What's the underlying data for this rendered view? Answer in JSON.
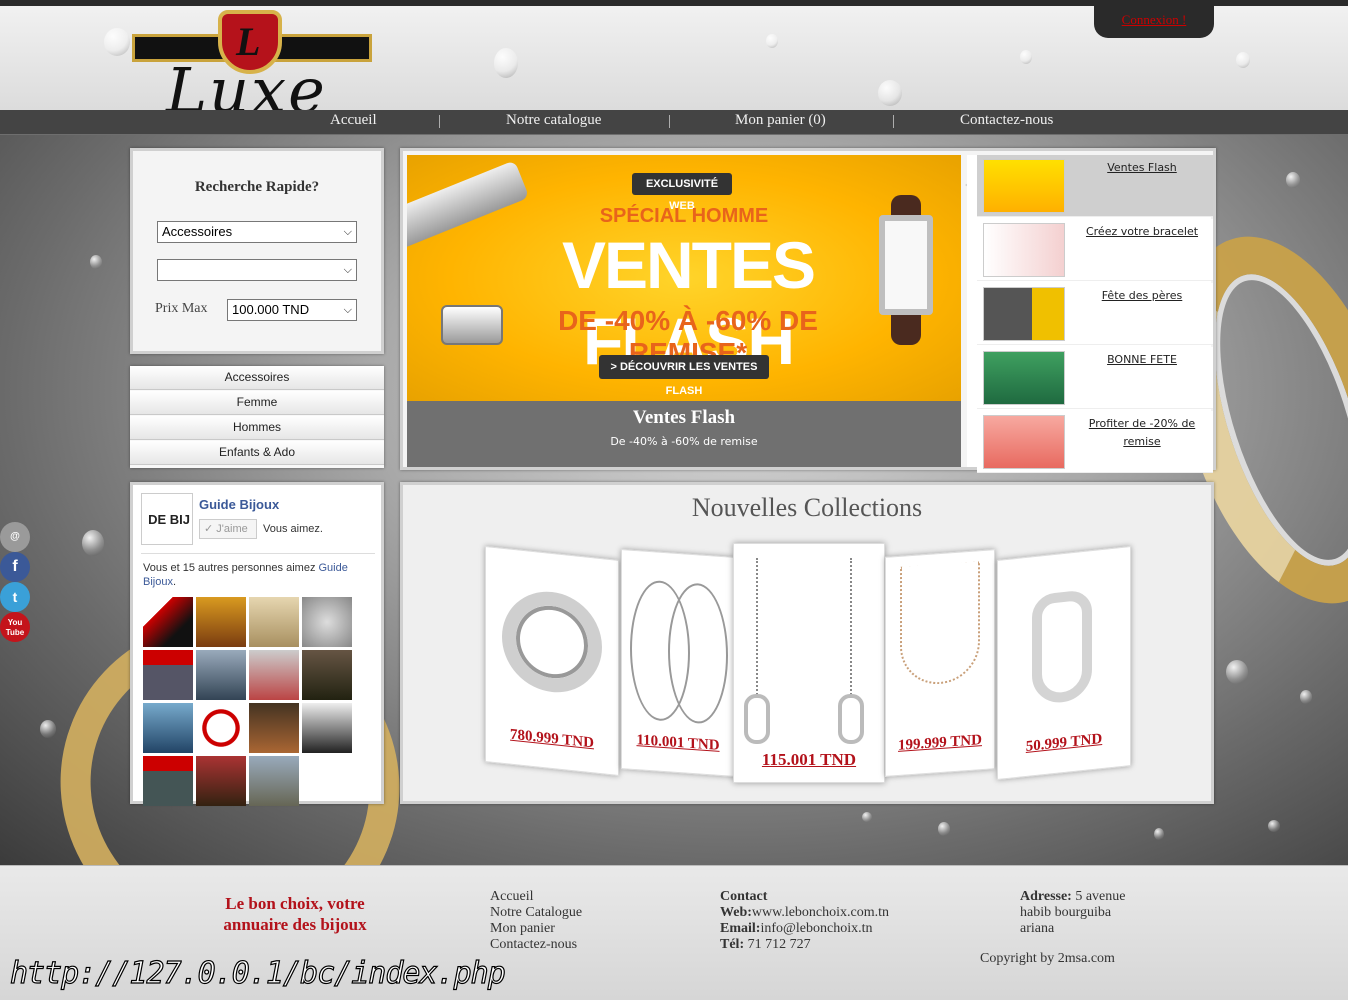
{
  "header": {
    "logo_text": "Luxe",
    "logo_letter": "L",
    "connexion_label": "Connexion !"
  },
  "nav": {
    "items": [
      "Accueil",
      "Notre catalogue",
      "Mon panier (0)",
      "Contactez-nous"
    ],
    "separator": "|"
  },
  "search": {
    "title": "Recherche Rapide?",
    "category_value": "Accessoires",
    "subcategory_value": "",
    "price_label": "Prix Max",
    "price_value": "100.000 TND"
  },
  "categories": [
    "Accessoires",
    "Femme",
    "Hommes",
    "Enfants & Ado"
  ],
  "facebook": {
    "page_name": "Guide Bijoux",
    "logo_text": "DE BIJ",
    "like_label": "J'aime",
    "you_like": "Vous aimez.",
    "friends_text": "Vous et 15 autres personnes aimez ",
    "friends_link": "Guide Bijoux",
    "friends_end": "."
  },
  "slider": {
    "banner": {
      "tag": "EXCLUSIVITÉ WEB",
      "subtitle": "SPÉCIAL HOMME",
      "title": "VENTES FLASH",
      "discount": "DE -40% À -60% DE REMISE*",
      "button": "> DÉCOUVRIR LES VENTES FLASH"
    },
    "caption_title": "Ventes Flash",
    "caption_desc": "De -40% à -60% de remise",
    "thumbs": [
      "Ventes Flash",
      "Créez votre bracelet",
      "Fête des pères",
      "BONNE FETE",
      "Profiter de -20% de remise"
    ]
  },
  "collections": {
    "title": "Nouvelles Collections",
    "prices": [
      "780.999 TND",
      "110.001 TND",
      "115.001 TND",
      "199.999 TND",
      "50.999 TND"
    ]
  },
  "social": [
    "mail-icon",
    "facebook-icon",
    "twitter-icon",
    "youtube-icon"
  ],
  "social_labels": [
    "@",
    "f",
    "t",
    "You Tube"
  ],
  "footer": {
    "slogan": "Le bon choix, votre annuaire des bijoux",
    "links": [
      "Accueil",
      "Notre Catalogue",
      "Mon panier",
      "Contactez-nous"
    ],
    "contact_title": "Contact",
    "web_label": "Web:",
    "web_value": "www.lebonchoix.com.tn",
    "email_label": "Email:",
    "email_value": "info@lebonchoix.tn",
    "tel_label": "Tél:",
    "tel_value": " 71 712 727",
    "address_label": "Adresse:",
    "address_value": " 5 avenue habib bourguiba ariana",
    "copyright": "Copyright by 2msa.com"
  },
  "statusbar_url": "http://127.0.0.1/bc/index.php",
  "colors": {
    "accent_red": "#b3121b",
    "nav_bg": "#444444",
    "link_blue": "#3b5998"
  }
}
